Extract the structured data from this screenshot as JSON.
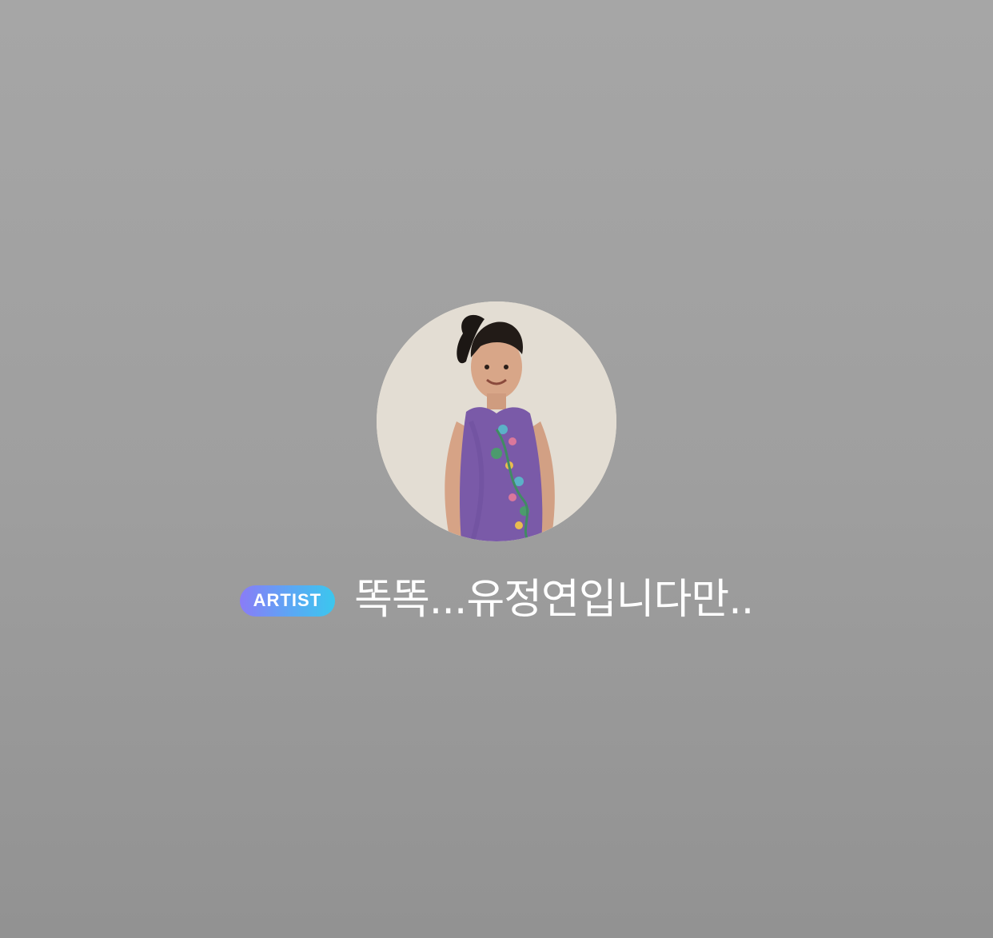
{
  "profile": {
    "badge_label": "ARTIST",
    "badge_gradient": [
      "#8a7cf7",
      "#5aa8f4",
      "#3bc7ee"
    ],
    "name": "똑똑...유정연입니다만..",
    "avatar_icon": "avatar-photo"
  },
  "colors": {
    "background_top": "#a6a6a6",
    "background_bottom": "#929292",
    "text": "#ffffff"
  }
}
